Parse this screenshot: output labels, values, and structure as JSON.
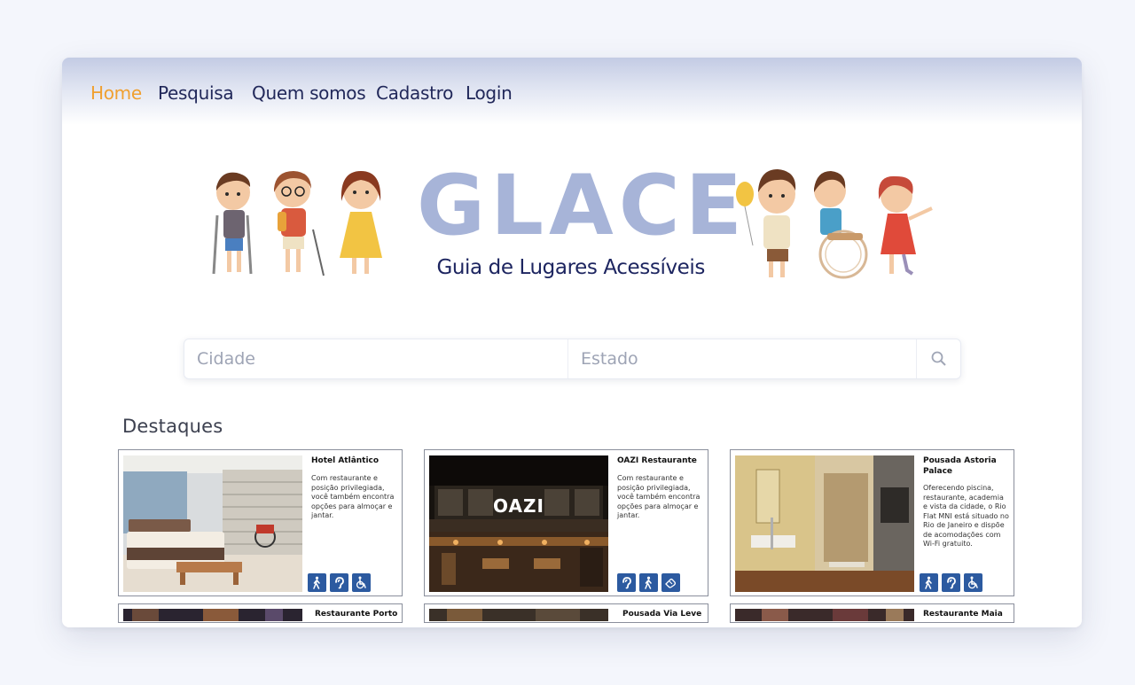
{
  "nav": {
    "items": [
      {
        "label": "Home",
        "active": true
      },
      {
        "label": "Pesquisa",
        "active": false
      },
      {
        "label": "Quem somos",
        "active": false
      },
      {
        "label": "Cadastro",
        "active": false
      },
      {
        "label": "Login",
        "active": false
      }
    ]
  },
  "hero": {
    "logo_text": "GLACE",
    "tagline": "Guia de Lugares Acessíveis"
  },
  "search": {
    "city_placeholder": "Cidade",
    "state_placeholder": "Estado",
    "icon": "search-icon"
  },
  "featured": {
    "title": "Destaques",
    "cards": [
      {
        "name": "Hotel Atlântico",
        "description": "Com restaurante e posição privilegiada, você também encontra opções para almoçar e jantar.",
        "icons": [
          "walking-person-icon",
          "hearing-icon",
          "wheelchair-icon"
        ]
      },
      {
        "name": "OAZI Restaurante",
        "photo_sign": "OAZI",
        "description": "Com restaurante e posição privilegiada, você também encontra opções para almoçar e jantar.",
        "icons": [
          "hearing-icon",
          "walking-person-icon",
          "sign-language-icon"
        ]
      },
      {
        "name": "Pousada Astoria Palace",
        "description": "Oferecendo piscina, restaurante, academia e vista da cidade, o Rio Flat MNI está situado no Rio de Janeiro e dispõe de acomodações com Wi-Fi gratuito.",
        "icons": [
          "walking-person-icon",
          "hearing-icon",
          "wheelchair-icon"
        ]
      },
      {
        "name": "Restaurante Porto"
      },
      {
        "name": "Pousada Via Leve"
      },
      {
        "name": "Restaurante Maia"
      }
    ]
  },
  "colors": {
    "nav_active": "#f0a030",
    "nav_text": "#21285a",
    "logo": "#a7b4d8",
    "tagline": "#1d2560",
    "accessibility_icon_bg": "#2c5aa0"
  }
}
